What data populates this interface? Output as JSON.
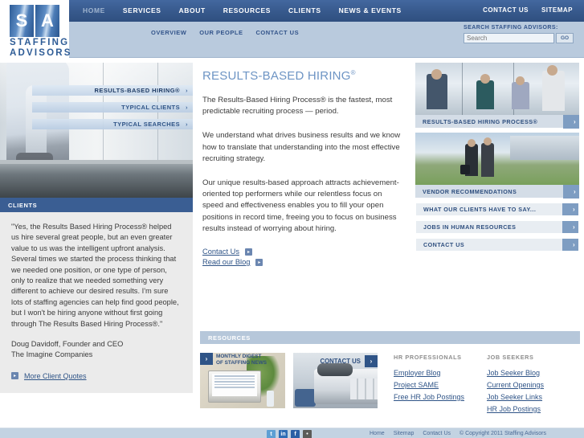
{
  "brand": {
    "tile_s": "S",
    "tile_a": "A",
    "wordmark_line1": "STAFFING",
    "wordmark_line2": "ADVISORS"
  },
  "header": {
    "main_nav": [
      {
        "label": "HOME",
        "active": true
      },
      {
        "label": "SERVICES",
        "active": false
      },
      {
        "label": "ABOUT",
        "active": false
      },
      {
        "label": "RESOURCES",
        "active": false
      },
      {
        "label": "CLIENTS",
        "active": false
      },
      {
        "label": "NEWS & EVENTS",
        "active": false
      }
    ],
    "util_nav": [
      {
        "label": "CONTACT US"
      },
      {
        "label": "SITEMAP"
      }
    ],
    "sub_nav": [
      {
        "label": "OVERVIEW"
      },
      {
        "label": "OUR PEOPLE"
      },
      {
        "label": "CONTACT US"
      }
    ],
    "search": {
      "label": "SEARCH STAFFING ADVISORS:",
      "placeholder": "Search",
      "value": "",
      "button": "GO"
    }
  },
  "hero": {
    "tabs": [
      {
        "label": "RESULTS-BASED HIRING®",
        "chev": "›",
        "active": true
      },
      {
        "label": "TYPICAL CLIENTS",
        "chev": "›",
        "active": false
      },
      {
        "label": "TYPICAL SEARCHES",
        "chev": "›",
        "active": false
      }
    ]
  },
  "clients_panel": {
    "heading": "CLIENTS",
    "quote": "\"Yes, the Results Based Hiring Process® helped us hire several great people, but an even greater value to us was the intelligent upfront analysis. Several times we started the process thinking that we needed one position, or one type of person, only to realize that we needed something very different to achieve our desired results. I'm sure lots of staffing agencies can help find good people, but I won't be hiring anyone without first going through The Results Based Hiring Process®.\"",
    "attrib_line1": "Doug Davidoff, Founder and CEO",
    "attrib_line2": "The Imagine Companies",
    "more_link": "More Client Quotes",
    "more_icon": "▸"
  },
  "main": {
    "title": "RESULTS-BASED HIRING",
    "title_sup": "®",
    "paragraphs": [
      "The Results-Based Hiring Process® is the fastest, most predictable recruiting process — period.",
      "We understand what drives business results and we know how to translate that understanding into the most effective recruiting strategy.",
      "Our unique results-based approach attracts achievement-oriented top performers while our relentless focus on speed and effectiveness enables you to fill your open positions in record time, freeing you to focus on business results instead of worrying about hiring."
    ],
    "links": [
      {
        "label": "Contact Us",
        "icon": "▸"
      },
      {
        "label": "Read our Blog",
        "icon": "▸"
      }
    ]
  },
  "promos": [
    {
      "label": "RESULTS-BASED HIRING PROCESS®",
      "go": "›",
      "image": "meeting-photo"
    },
    {
      "label": "VENDOR RECOMMENDATIONS",
      "go": "›",
      "image": "outdoor-photo"
    }
  ],
  "right_links": [
    {
      "label": "WHAT OUR CLIENTS HAVE TO SAY...",
      "go": "›"
    },
    {
      "label": "JOBS IN HUMAN RESOURCES",
      "go": "›"
    },
    {
      "label": "CONTACT US",
      "go": "›"
    }
  ],
  "resources": {
    "heading": "RESOURCES",
    "cards": [
      {
        "line1": "MONTHLY DIGEST",
        "line2": "OF STAFFING NEWS",
        "go": "›",
        "image": "laptop-plant-photo"
      },
      {
        "line1": "CONTACT US",
        "line2": "",
        "go": "›",
        "image": "office-phone-photo"
      }
    ],
    "columns": [
      {
        "title": "HR PROFESSIONALS",
        "links": [
          "Employer Blog",
          "Project SAME",
          "Free HR Job Postings"
        ]
      },
      {
        "title": "JOB SEEKERS",
        "links": [
          "Job Seeker Blog",
          "Current Openings",
          "Job Seeker Links",
          "HR Job Postings"
        ]
      }
    ]
  },
  "footer": {
    "social": [
      {
        "name": "twitter-icon",
        "glyph": "t"
      },
      {
        "name": "linkedin-icon",
        "glyph": "in"
      },
      {
        "name": "facebook-icon",
        "glyph": "f"
      },
      {
        "name": "rss-icon",
        "glyph": "•"
      }
    ],
    "links": [
      "Home",
      "Sitemap",
      "Contact Us"
    ],
    "copyright": "© Copyright 2011 Staffing Advisors"
  },
  "colors": {
    "nav_blue": "#37598c",
    "sub_blue": "#b9cadd",
    "accent": "#2f5487",
    "title_blue": "#6d94c4",
    "panel_gray": "#ebebeb"
  }
}
